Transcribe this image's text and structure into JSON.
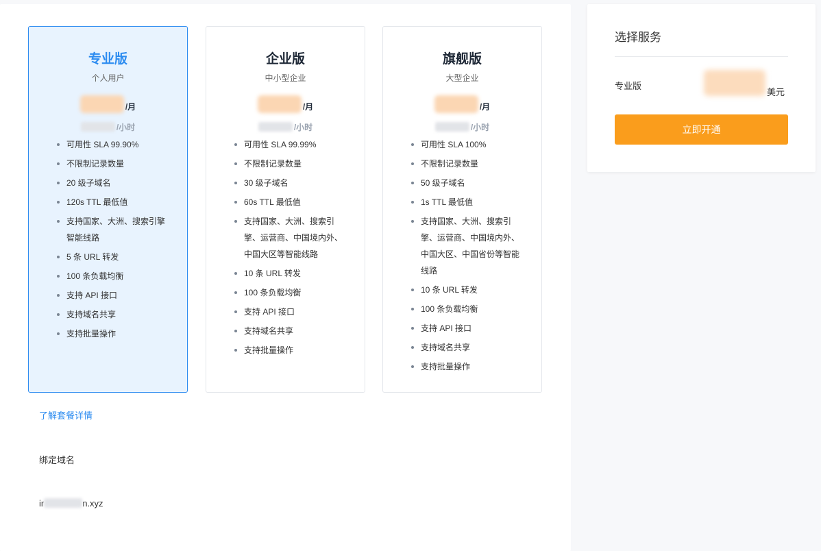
{
  "plans": [
    {
      "name": "专业版",
      "audience": "个人用户",
      "price_unit": "/月",
      "hour_unit": "/小时",
      "features": [
        "可用性 SLA 99.90%",
        "不限制记录数量",
        "20 级子域名",
        "120s TTL 最低值",
        "支持国家、大洲、搜索引擎智能线路",
        "5 条 URL 转发",
        "100 条负载均衡",
        "支持 API 接口",
        "支持域名共享",
        "支持批量操作"
      ]
    },
    {
      "name": "企业版",
      "audience": "中小型企业",
      "price_unit": "/月",
      "hour_unit": "/小时",
      "features": [
        "可用性 SLA 99.99%",
        "不限制记录数量",
        "30 级子域名",
        "60s TTL 最低值",
        "支持国家、大洲、搜索引擎、运营商、中国境内外、中国大区等智能线路",
        "10 条 URL 转发",
        "100 条负载均衡",
        "支持 API 接口",
        "支持域名共享",
        "支持批量操作"
      ]
    },
    {
      "name": "旗舰版",
      "audience": "大型企业",
      "price_unit": "/月",
      "hour_unit": "/小时",
      "features": [
        "可用性 SLA 100%",
        "不限制记录数量",
        "50 级子域名",
        "1s TTL 最低值",
        "支持国家、大洲、搜索引擎、运营商、中国境内外、中国大区、中国省份等智能线路",
        "10 条 URL 转发",
        "100 条负载均衡",
        "支持 API 接口",
        "支持域名共享",
        "支持批量操作"
      ]
    }
  ],
  "details_link": "了解套餐详情",
  "bind_domain_label": "绑定域名",
  "domain": {
    "prefix": "ir",
    "suffix": "n.xyz"
  },
  "summary": {
    "title": "选择服务",
    "plan": "专业版",
    "currency": "美元",
    "button": "立即开通"
  },
  "colors": {
    "accent": "#2d8cf0",
    "selected_bg": "#e8f3fe",
    "button": "#fa9d1c"
  }
}
